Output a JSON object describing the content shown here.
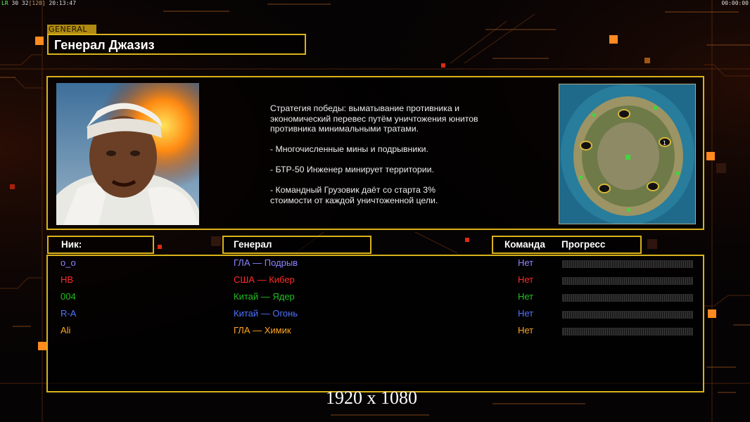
{
  "status": {
    "fps_prefix": "LR",
    "fps_values": "30 32",
    "fps_bracket": "[120]",
    "time": "20:13:47",
    "clock": "00:00:00"
  },
  "general_tag": "GENERAL",
  "title": "Генерал Джазиз",
  "strategy": "Стратегия победы: выматывание противника и\n экономический перевес путём уничтожения юнитов\n противника минимальными тратами.\n\n- Многочисленные мины и подрывники.\n\n- БТР-50 Инженер минирует территории.\n\n- Командный Грузовик даёт со старта 3%\n стоимости от каждой уничтоженной цели.",
  "headers": {
    "nick": "Ник:",
    "general": "Генерал",
    "team": "Команда",
    "progress": "Прогресс"
  },
  "players": [
    {
      "nick": "o_o",
      "general": "ГЛА — Подрыв",
      "team": "Нет",
      "color": "#8a84ff",
      "progress": 0
    },
    {
      "nick": "HB",
      "general": "США — Кибер",
      "team": "Нет",
      "color": "#ff2a2a",
      "progress": 0
    },
    {
      "nick": "004",
      "general": "Китай — Ядер",
      "team": "Нет",
      "color": "#1fc21f",
      "progress": 0
    },
    {
      "nick": "R-A",
      "general": "Китай — Огонь",
      "team": "Нет",
      "color": "#4f73ff",
      "progress": 0
    },
    {
      "nick": "Ali",
      "general": "ГЛА — Химик",
      "team": "Нет",
      "color": "#ffa51f",
      "progress": 0
    }
  ],
  "map_marker": "1",
  "resolution": "1920 x 1080",
  "colors": {
    "frame": "#d9b21c",
    "accent": "#ff8a1f"
  }
}
